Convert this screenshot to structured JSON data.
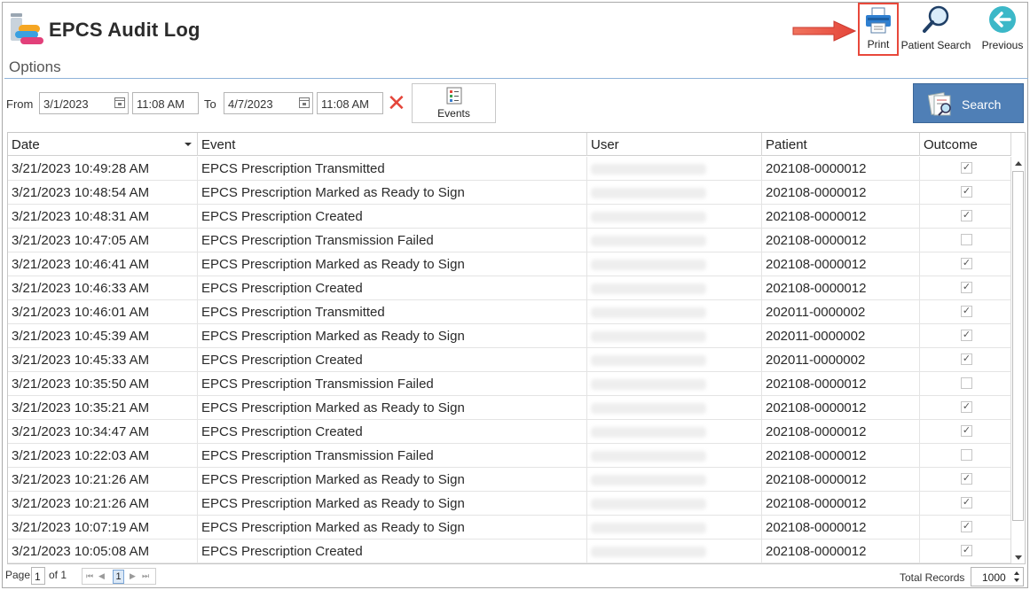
{
  "app": {
    "title": "EPCS Audit Log",
    "options_label": "Options"
  },
  "toolbar": {
    "print_label": "Print",
    "patient_search_label": "Patient Search",
    "previous_label": "Previous"
  },
  "filters": {
    "from_label": "From",
    "from_date": "3/1/2023",
    "from_time": "11:08 AM",
    "to_label": "To",
    "to_date": "4/7/2023",
    "to_time": "11:08 AM",
    "events_label": "Events",
    "search_label": "Search"
  },
  "grid": {
    "columns": [
      "Date",
      "Event",
      "User",
      "Patient",
      "Outcome"
    ],
    "rows": [
      {
        "date": "3/21/2023 10:49:28 AM",
        "event": "EPCS Prescription Transmitted",
        "patient": "202108-0000012",
        "outcome": true
      },
      {
        "date": "3/21/2023 10:48:54 AM",
        "event": "EPCS Prescription Marked as Ready to Sign",
        "patient": "202108-0000012",
        "outcome": true
      },
      {
        "date": "3/21/2023 10:48:31 AM",
        "event": "EPCS Prescription Created",
        "patient": "202108-0000012",
        "outcome": true
      },
      {
        "date": "3/21/2023 10:47:05 AM",
        "event": "EPCS Prescription Transmission Failed",
        "patient": "202108-0000012",
        "outcome": false
      },
      {
        "date": "3/21/2023 10:46:41 AM",
        "event": "EPCS Prescription Marked as Ready to Sign",
        "patient": "202108-0000012",
        "outcome": true
      },
      {
        "date": "3/21/2023 10:46:33 AM",
        "event": "EPCS Prescription Created",
        "patient": "202108-0000012",
        "outcome": true
      },
      {
        "date": "3/21/2023 10:46:01 AM",
        "event": "EPCS Prescription Transmitted",
        "patient": "202011-0000002",
        "outcome": true
      },
      {
        "date": "3/21/2023 10:45:39 AM",
        "event": "EPCS Prescription Marked as Ready to Sign",
        "patient": "202011-0000002",
        "outcome": true
      },
      {
        "date": "3/21/2023 10:45:33 AM",
        "event": "EPCS Prescription Created",
        "patient": "202011-0000002",
        "outcome": true
      },
      {
        "date": "3/21/2023 10:35:50 AM",
        "event": "EPCS Prescription Transmission Failed",
        "patient": "202108-0000012",
        "outcome": false
      },
      {
        "date": "3/21/2023 10:35:21 AM",
        "event": "EPCS Prescription Marked as Ready to Sign",
        "patient": "202108-0000012",
        "outcome": true
      },
      {
        "date": "3/21/2023 10:34:47 AM",
        "event": "EPCS Prescription Created",
        "patient": "202108-0000012",
        "outcome": true
      },
      {
        "date": "3/21/2023 10:22:03 AM",
        "event": "EPCS Prescription Transmission Failed",
        "patient": "202108-0000012",
        "outcome": false
      },
      {
        "date": "3/21/2023 10:21:26 AM",
        "event": "EPCS Prescription Marked as Ready to Sign",
        "patient": "202108-0000012",
        "outcome": true
      },
      {
        "date": "3/21/2023 10:21:26 AM",
        "event": "EPCS Prescription Marked as Ready to Sign",
        "patient": "202108-0000012",
        "outcome": true
      },
      {
        "date": "3/21/2023 10:07:19 AM",
        "event": "EPCS Prescription Marked as Ready to Sign",
        "patient": "202108-0000012",
        "outcome": true
      },
      {
        "date": "3/21/2023 10:05:08 AM",
        "event": "EPCS Prescription Created",
        "patient": "202108-0000012",
        "outcome": true
      }
    ]
  },
  "footer": {
    "page_label": "Page",
    "page_value": "1",
    "of_label": "of 1",
    "current_page": "1",
    "total_records_label": "Total Records",
    "total_records_value": "1000"
  },
  "colors": {
    "accent": "#4f7fb6",
    "highlight": "#e8483b"
  }
}
